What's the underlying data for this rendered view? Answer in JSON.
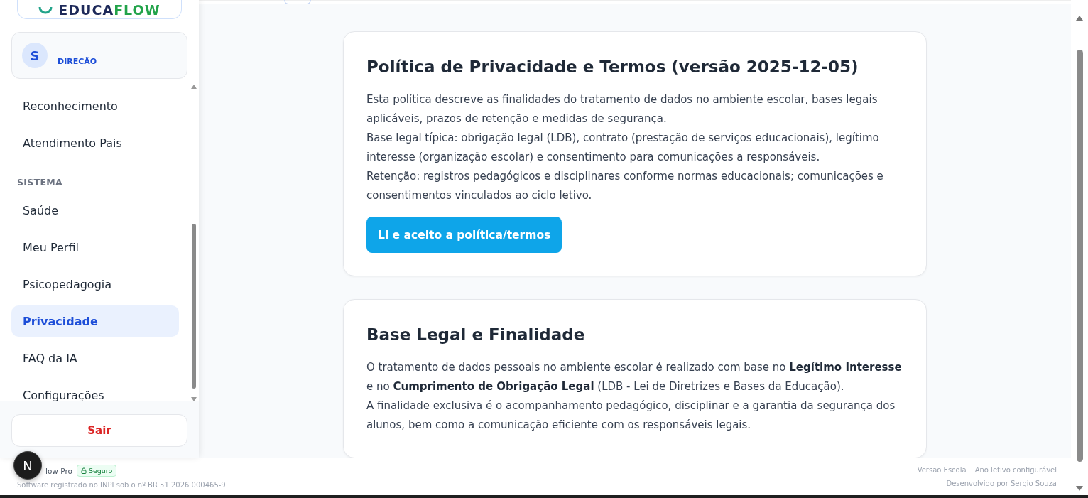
{
  "logo": {
    "dark": "EDUCA",
    "green": "FLOW"
  },
  "user": {
    "initial": "S",
    "role": "DIREÇÃO"
  },
  "nav": [
    {
      "kind": "item",
      "label": "Reconhecimento",
      "selected": false
    },
    {
      "kind": "item",
      "label": "Atendimento Pais",
      "selected": false
    },
    {
      "kind": "section",
      "label": "SISTEMA"
    },
    {
      "kind": "item",
      "label": "Saúde",
      "selected": false
    },
    {
      "kind": "item",
      "label": "Meu Perfil",
      "selected": false
    },
    {
      "kind": "item",
      "label": "Psicopedagogia",
      "selected": false
    },
    {
      "kind": "item",
      "label": "Privacidade",
      "selected": true
    },
    {
      "kind": "item",
      "label": "FAQ da IA",
      "selected": false
    },
    {
      "kind": "item",
      "label": "Configurações",
      "selected": false
    }
  ],
  "logout": "Sair",
  "cards": [
    {
      "title": "Política de Privacidade e Termos (versão 2025-12-05)",
      "paragraphs": [
        "Esta política descreve as finalidades do tratamento de dados no ambiente escolar, bases legais aplicáveis, prazos de retenção e medidas de segurança.",
        "Base legal típica: obrigação legal (LDB), contrato (prestação de serviços educacionais), legítimo interesse (organização escolar) e consentimento para comunicações a responsáveis.",
        "Retenção: registros pedagógicos e disciplinares conforme normas educacionais; comunicações e consentimentos vinculados ao ciclo letivo."
      ],
      "button": "Li e aceito a política/termos"
    },
    {
      "title": "Base Legal e Finalidade",
      "paragraphs": [
        "O tratamento de dados pessoais no ambiente escolar é realizado com base no **Legítimo Interesse** e no **Cumprimento de Obrigação Legal** (LDB - Lei de Diretrizes e Bases da Educação).",
        "A finalidade exclusiva é o acompanhamento pedagógico, disciplinar e a garantia da segurança dos alunos, bem como a comunicação eficiente com os responsáveis legais."
      ]
    }
  ],
  "footer": {
    "dev_badge": "N",
    "brand": "low Pro",
    "badge": "Seguro",
    "registration": "Software registrado no INPI sob o nº BR 51 2026 000465-9",
    "links": [
      "Versão Escola",
      "Ano letivo configurável"
    ],
    "credit": "Desenvolvido por Sergio Souza"
  }
}
